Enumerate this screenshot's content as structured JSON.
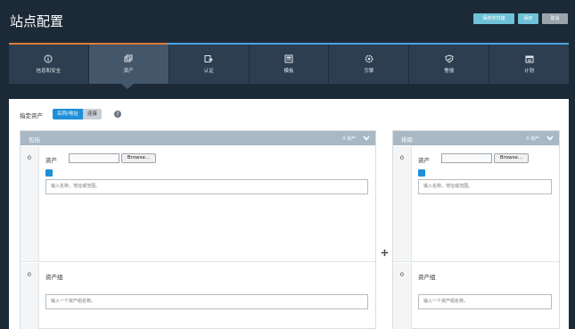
{
  "header": {
    "title": "站点配置",
    "buttons": {
      "save_and_scan": "保存并扫描",
      "save": "保存",
      "cancel": "取消"
    }
  },
  "tabs": [
    {
      "label": "信息和安全",
      "icon": "info-icon"
    },
    {
      "label": "资产",
      "icon": "assets-icon",
      "active": true
    },
    {
      "label": "认证",
      "icon": "credentials-icon"
    },
    {
      "label": "模板",
      "icon": "template-icon"
    },
    {
      "label": "引擎",
      "icon": "engine-icon"
    },
    {
      "label": "警报",
      "icon": "shield-icon"
    },
    {
      "label": "计划",
      "icon": "calendar-icon"
    }
  ],
  "specify": {
    "label": "指定资产",
    "toggle_on": "名称/地址",
    "toggle_off": "连接"
  },
  "include": {
    "title": "包括",
    "count": "0 资产",
    "assets_count": "0",
    "assets_label": "资产",
    "browse": "Browse...",
    "assets_placeholder": "输入名称，地址或范围。",
    "groups_count": "0",
    "groups_label": "资产组",
    "groups_placeholder": "输入一个资产组名称。"
  },
  "exclude": {
    "title": "排除",
    "count": "0 资产",
    "assets_count": "0",
    "assets_label": "资产",
    "browse": "Browse...",
    "assets_placeholder": "输入名称，地址或范围。",
    "groups_count": "0",
    "groups_label": "资产组",
    "groups_placeholder": "输入一个资产组名称。"
  },
  "colors": {
    "background": "#1c2a38",
    "accent": "#1e8fd8",
    "active_tab_line": "#e07b3a"
  }
}
